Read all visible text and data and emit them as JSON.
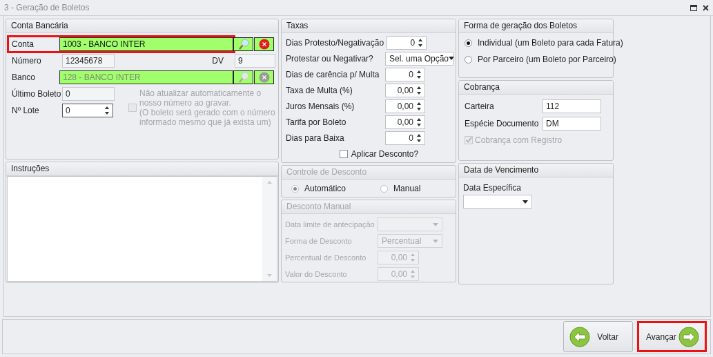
{
  "window": {
    "title": "3 - Geração de Boletos"
  },
  "conta_bancaria": {
    "title": "Conta Bancária",
    "conta": {
      "label": "Conta",
      "value": "1003 - BANCO INTER",
      "disabled": false,
      "highlighted": true
    },
    "numero": {
      "label": "Número",
      "value": "12345678"
    },
    "dv": {
      "label": "DV",
      "value": "9"
    },
    "banco": {
      "label": "Banco",
      "value": "128 - BANCO INTER",
      "disabled": true,
      "highlighted": false
    },
    "ultimo_boleto": {
      "label": "Último Boleto",
      "value": "0"
    },
    "lote": {
      "label": "Nº Lote",
      "value": "0"
    },
    "nao_atualizar": {
      "lines": [
        "Não atualizar automaticamente o nosso número ao gravar.",
        "(O boleto será gerado com o número informado mesmo que já exista um)"
      ],
      "checked": false,
      "disabled": true
    }
  },
  "instrucoes": {
    "title": "Instruções"
  },
  "taxas": {
    "title": "Taxas",
    "fields": [
      {
        "label": "Dias Protesto/Negativação",
        "value": "0",
        "kind": "spin"
      },
      {
        "label": "Protestar ou Negativar?",
        "value": "Sel. uma Opção",
        "kind": "select"
      },
      {
        "label": "Dias de carência p/ Multa",
        "value": "0",
        "kind": "spin"
      },
      {
        "label": "Taxa de Multa (%)",
        "value": "0,00",
        "kind": "spin"
      },
      {
        "label": "Juros Mensais (%)",
        "value": "0,00",
        "kind": "spin"
      },
      {
        "label": "Tarifa por Boleto",
        "value": "0,00",
        "kind": "spin"
      },
      {
        "label": "Dias para Baixa",
        "value": "0",
        "kind": "spin"
      }
    ],
    "aplicar_desconto": {
      "label": "Aplicar Desconto?",
      "checked": false
    }
  },
  "controle_desconto": {
    "title": "Controle de Desconto",
    "disabled": true,
    "options": [
      {
        "label": "Automático",
        "selected": true
      },
      {
        "label": "Manual",
        "selected": false
      }
    ]
  },
  "desconto_manual": {
    "title": "Desconto Manual",
    "disabled": true,
    "fields": [
      {
        "label": "Data limite de antecipação",
        "kind": "select"
      },
      {
        "label": "Forma de Desconto",
        "value": "Percentual",
        "kind": "select"
      },
      {
        "label": "Percentual de Desconto",
        "value": "0,00",
        "kind": "spin"
      },
      {
        "label": "Valor do Desconto",
        "value": "0,00",
        "kind": "spin"
      }
    ]
  },
  "forma_geracao": {
    "title": "Forma de geração dos Boletos",
    "options": [
      {
        "label": "Individual (um Boleto para cada Fatura)",
        "selected": true
      },
      {
        "label": "Por Parceiro (um Boleto por Parceiro)",
        "selected": false
      }
    ]
  },
  "cobranca": {
    "title": "Cobrança",
    "fields": [
      {
        "label": "Carteira",
        "value": "112"
      },
      {
        "label": "Espécie Documento",
        "value": "DM"
      }
    ],
    "com_registro": {
      "label": "Cobrança com Registro",
      "checked": true,
      "disabled": true
    }
  },
  "data_vencimento": {
    "title": "Data de Vencimento",
    "field": {
      "label": "Data Específica",
      "kind": "select"
    }
  },
  "buttons": [
    {
      "label": "Voltar",
      "kind": "back",
      "highlighted": false
    },
    {
      "label": "Avançar",
      "kind": "next",
      "highlighted": true
    }
  ]
}
